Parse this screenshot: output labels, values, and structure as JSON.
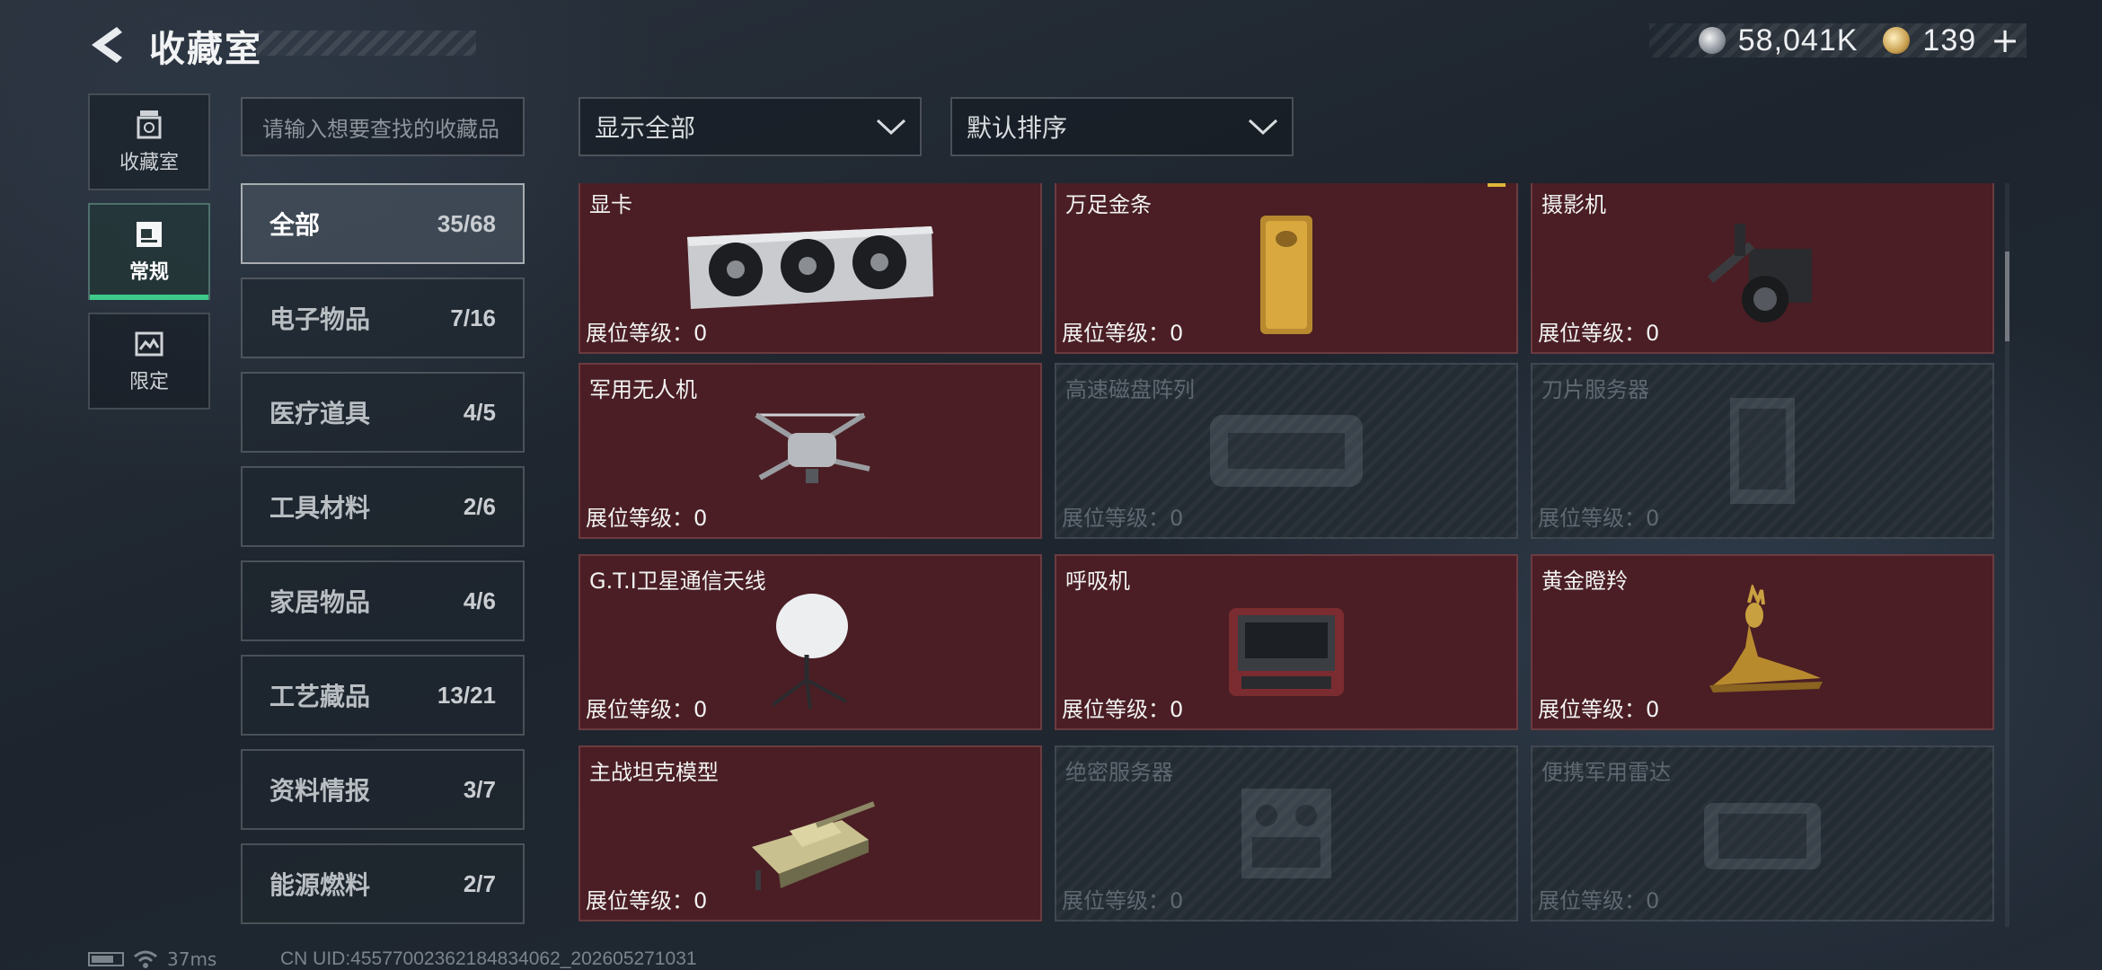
{
  "header": {
    "title": "收藏室",
    "currency": [
      {
        "icon": "silver-coin-icon",
        "value": "58,041K"
      },
      {
        "icon": "gold-coin-icon",
        "value": "139",
        "plus": "+"
      }
    ]
  },
  "side_tabs": [
    {
      "label": "收藏室",
      "icon": "vault-icon",
      "active": false
    },
    {
      "label": "常规",
      "icon": "regular-icon",
      "active": true
    },
    {
      "label": "限定",
      "icon": "limited-icon",
      "active": false
    }
  ],
  "search": {
    "placeholder": "请输入想要查找的收藏品"
  },
  "filters": {
    "display": {
      "value": "显示全部"
    },
    "sort": {
      "value": "默认排序"
    }
  },
  "categories": [
    {
      "name": "全部",
      "count": "35/68",
      "active": true
    },
    {
      "name": "电子物品",
      "count": "7/16"
    },
    {
      "name": "医疗道具",
      "count": "4/5"
    },
    {
      "name": "工具材料",
      "count": "2/6"
    },
    {
      "name": "家居物品",
      "count": "4/6"
    },
    {
      "name": "工艺藏品",
      "count": "13/21"
    },
    {
      "name": "资料情报",
      "count": "3/7"
    },
    {
      "name": "能源燃料",
      "count": "2/7"
    }
  ],
  "level_label": "展位等级：",
  "items": [
    {
      "name": "显卡",
      "level": "0",
      "locked": false,
      "icon": "graphics-card-icon"
    },
    {
      "name": "万足金条",
      "level": "0",
      "locked": false,
      "icon": "gold-bar-icon",
      "badge": true
    },
    {
      "name": "摄影机",
      "level": "0",
      "locked": false,
      "icon": "camera-icon"
    },
    {
      "name": "军用无人机",
      "level": "0",
      "locked": false,
      "icon": "drone-icon"
    },
    {
      "name": "高速磁盘阵列",
      "level": "0",
      "locked": true,
      "icon": "disk-array-icon"
    },
    {
      "name": "刀片服务器",
      "level": "0",
      "locked": true,
      "icon": "blade-server-icon"
    },
    {
      "name": "G.T.I卫星通信天线",
      "level": "0",
      "locked": false,
      "icon": "satellite-antenna-icon"
    },
    {
      "name": "呼吸机",
      "level": "0",
      "locked": false,
      "icon": "ventilator-icon"
    },
    {
      "name": "黄金瞪羚",
      "level": "0",
      "locked": false,
      "icon": "gold-gazelle-icon"
    },
    {
      "name": "主战坦克模型",
      "level": "0",
      "locked": false,
      "icon": "tank-model-icon"
    },
    {
      "name": "绝密服务器",
      "level": "0",
      "locked": true,
      "icon": "secret-server-icon"
    },
    {
      "name": "便携军用雷达",
      "level": "0",
      "locked": true,
      "icon": "portable-radar-icon"
    }
  ],
  "status": {
    "ping": "37ms",
    "uid": "CN UID:4557700236218483406​2_202605271031"
  }
}
